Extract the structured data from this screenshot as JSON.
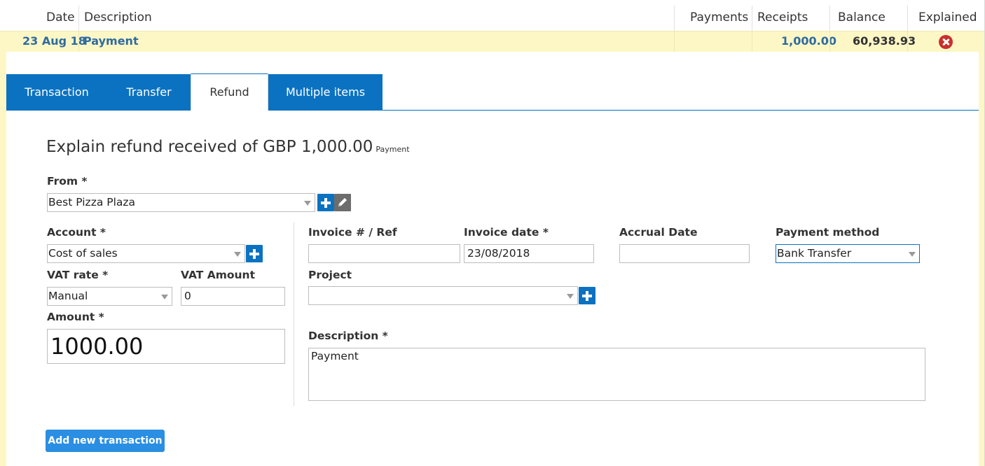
{
  "table": {
    "columns": {
      "date": "Date",
      "description": "Description",
      "payments": "Payments",
      "receipts": "Receipts",
      "balance": "Balance",
      "explained": "Explained"
    },
    "row": {
      "date": "23 Aug 18",
      "description": "Payment",
      "payments": "",
      "receipts": "1,000.00",
      "balance": "60,938.93",
      "explained_icon": "unexplained-x-icon"
    }
  },
  "tabs": {
    "transaction": "Transaction",
    "transfer": "Transfer",
    "refund": "Refund",
    "multiple_items": "Multiple items",
    "active": "refund"
  },
  "form": {
    "heading": "Explain refund received of GBP 1,000.00",
    "heading_tag": "Payment",
    "from_label": "From *",
    "from_value": "Best Pizza Plaza",
    "account_label": "Account *",
    "account_value": "Cost of sales",
    "vat_rate_label": "VAT rate *",
    "vat_rate_value": "Manual",
    "vat_amount_label": "VAT Amount",
    "vat_amount_value": "0",
    "amount_label": "Amount *",
    "amount_value": "1000.00",
    "invoice_ref_label": "Invoice # / Ref",
    "invoice_ref_value": "",
    "invoice_date_label": "Invoice date *",
    "invoice_date_value": "23/08/2018",
    "accrual_date_label": "Accrual Date",
    "accrual_date_value": "",
    "payment_method_label": "Payment method",
    "payment_method_value": "Bank Transfer",
    "project_label": "Project",
    "project_value": "",
    "description_label": "Description *",
    "description_value": "Payment",
    "add_button": "Add new transaction"
  },
  "colors": {
    "row_highlight": "#fdf7c6",
    "tab_blue": "#0b72c1",
    "link_blue": "#2f6b9f",
    "button_blue": "#2a8ee2",
    "error_red": "#c9302c"
  }
}
